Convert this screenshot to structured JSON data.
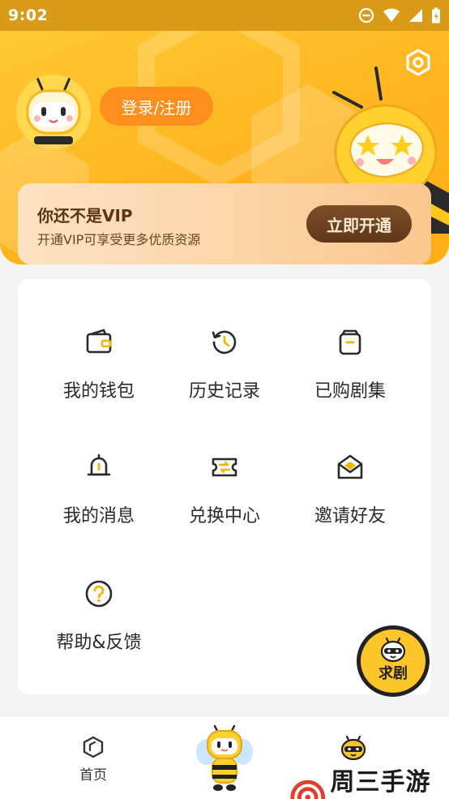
{
  "status_bar": {
    "time": "9:02"
  },
  "header": {
    "login_label": "登录/注册",
    "vip_title": "你还不是VIP",
    "vip_subtitle": "开通VIP可享受更多优质资源",
    "vip_button": "立即开通"
  },
  "menu": {
    "items": [
      {
        "label": "我的钱包",
        "icon": "wallet-icon"
      },
      {
        "label": "历史记录",
        "icon": "history-icon"
      },
      {
        "label": "已购剧集",
        "icon": "purchased-icon"
      },
      {
        "label": "我的消息",
        "icon": "bell-icon"
      },
      {
        "label": "兑换中心",
        "icon": "exchange-icon"
      },
      {
        "label": "邀请好友",
        "icon": "invite-mail-icon"
      },
      {
        "label": "帮助&反馈",
        "icon": "help-icon"
      }
    ]
  },
  "fab": {
    "label": "求剧"
  },
  "bottom_nav": {
    "home_label": "首页"
  },
  "watermark": {
    "text": "周三手游网"
  },
  "colors": {
    "accent": "#ffb51f",
    "vip_button": "#6a4020",
    "login_button": "#ff8f1c"
  }
}
